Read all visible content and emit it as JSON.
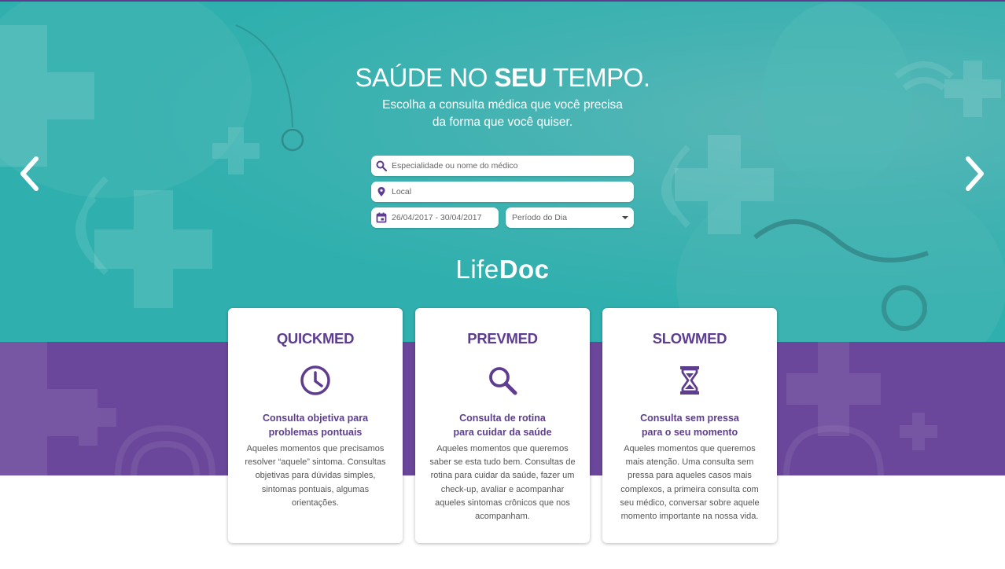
{
  "hero": {
    "headline_pre": "SAÚDE NO ",
    "headline_bold": "SEU",
    "headline_post": " TEMPO.",
    "subtitle_line1": "Escolha a consulta médica que você precisa",
    "subtitle_line2": "da forma que você quiser.",
    "bg_color": "#35b4b1"
  },
  "search": {
    "specialty_placeholder": "Especialidade ou nome do médico",
    "location_placeholder": "Local",
    "date_range": "26/04/2017 - 30/04/2017",
    "period_selected": "Período do Dia"
  },
  "carousel": {
    "prev_icon": "chevron-left-icon",
    "next_icon": "chevron-right-icon"
  },
  "brand": {
    "logo_light": "Life",
    "logo_bold": "Doc",
    "primary_color": "#5e3d8f",
    "band_color": "#6b479b"
  },
  "cards": [
    {
      "title": "QUICKMED",
      "icon": "clock-icon",
      "subtitle_line1": "Consulta objetiva para",
      "subtitle_line2": "problemas pontuais",
      "description": "Aqueles momentos que precisamos resolver “aquele” sintoma. Consultas objetivas para dúvidas simples, sintomas pontuais, algumas orientações."
    },
    {
      "title": "PREVMED",
      "icon": "magnifier-icon",
      "subtitle_line1": "Consulta de rotina",
      "subtitle_line2": "para cuidar da saúde",
      "description": "Aqueles momentos que queremos saber se esta tudo bem. Consultas de rotina para cuidar da saúde, fazer um check-up, avaliar e acompanhar aqueles sintomas crônicos que nos acompanham."
    },
    {
      "title": "SLOWMED",
      "icon": "hourglass-icon",
      "subtitle_line1": "Consulta sem pressa",
      "subtitle_line2": "para o seu momento",
      "description": "Aqueles momentos que queremos mais atenção. Uma consulta sem pressa para aqueles casos mais complexos, a primeira consulta com seu médico, conversar sobre aquele momento importante na nossa vida."
    }
  ]
}
